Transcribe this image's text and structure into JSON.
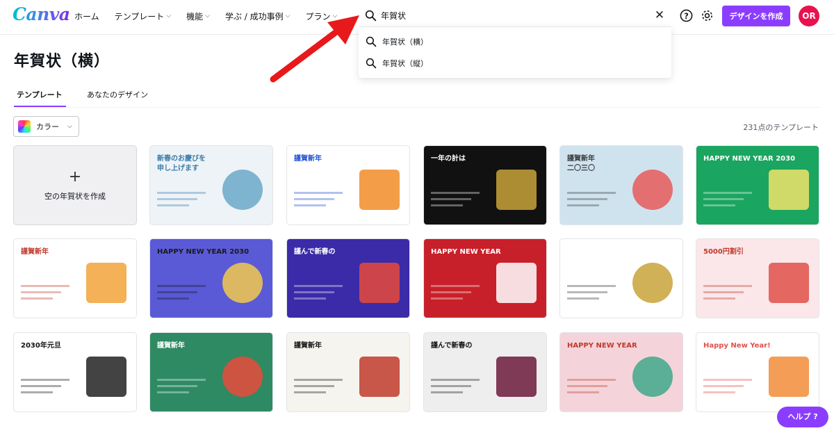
{
  "header": {
    "logo": "Canva",
    "nav": [
      {
        "label": "ホーム",
        "has_menu": false
      },
      {
        "label": "テンプレート",
        "has_menu": true
      },
      {
        "label": "機能",
        "has_menu": true
      },
      {
        "label": "学ぶ / 成功事例",
        "has_menu": true
      },
      {
        "label": "プラン",
        "has_menu": true
      }
    ],
    "search": {
      "value": "年賀状"
    },
    "create_button": "デザインを作成",
    "avatar_initials": "OR",
    "brand_color": "#8b3dff"
  },
  "suggestions": [
    "年賀状（横）",
    "年賀状（縦）"
  ],
  "page": {
    "title": "年賀状（横）",
    "tabs": [
      "テンプレート",
      "あなたのデザイン"
    ],
    "filter_label": "カラー",
    "count": "231点のテンプレート",
    "create_card_label": "空の年賀状を作成",
    "help_button": "ヘルプ ?"
  },
  "templates": [
    {
      "bg": "#eef3f7",
      "accent": "#6aa8c8",
      "text": "新春のお慶びを\n申し上げます",
      "color": "#3a7ca8"
    },
    {
      "bg": "#ffffff",
      "accent": "#f28c28",
      "text": "謹賀新年",
      "color": "#1f4fd1"
    },
    {
      "bg": "#111111",
      "accent": "#c9a33a",
      "text": "一年の計は",
      "color": "#ffffff"
    },
    {
      "bg": "#cfe3ef",
      "accent": "#e85b5b",
      "text": "謹賀新年\n二〇三〇",
      "color": "#3a3a3a"
    },
    {
      "bg": "#1aa560",
      "accent": "#f0e36a",
      "text": "HAPPY NEW YEAR 2030",
      "color": "#ffffff"
    },
    {
      "bg": "#ffffff",
      "accent": "#f2a33a",
      "text": "謹賀新年",
      "color": "#c0392b"
    },
    {
      "bg": "#5a5ad6",
      "accent": "#f2c94c",
      "text": "HAPPY NEW YEAR 2030",
      "color": "#1a1a1a"
    },
    {
      "bg": "#3b2ba8",
      "accent": "#e84a3a",
      "text": "謹んで新春の",
      "color": "#ffffff"
    },
    {
      "bg": "#c8202a",
      "accent": "#ffffff",
      "text": "HAPPY NEW YEAR",
      "color": "#ffffff"
    },
    {
      "bg": "#ffffff",
      "accent": "#c9a33a",
      "text": "",
      "color": "#333333"
    },
    {
      "bg": "#fbe7ea",
      "accent": "#e0504a",
      "text": "5000円割引",
      "color": "#c0392b"
    },
    {
      "bg": "#ffffff",
      "accent": "#222222",
      "text": "2030年元旦",
      "color": "#111111"
    },
    {
      "bg": "#2e8a63",
      "accent": "#e84a3a",
      "text": "謹賀新年",
      "color": "#ffffff"
    },
    {
      "bg": "#f6f4ee",
      "accent": "#c0392b",
      "text": "謹賀新年",
      "color": "#111111"
    },
    {
      "bg": "#eeeeee",
      "accent": "#6b1a3a",
      "text": "謹んで新春の",
      "color": "#111111"
    },
    {
      "bg": "#f4d4da",
      "accent": "#3fa88a",
      "text": "HAPPY NEW YEAR",
      "color": "#c0392b"
    },
    {
      "bg": "#ffffff",
      "accent": "#f28c3a",
      "text": "Happy New Year!",
      "color": "#e0504a"
    }
  ]
}
